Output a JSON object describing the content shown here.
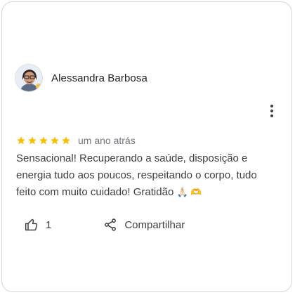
{
  "review": {
    "author_name": "Alessandra Barbosa",
    "rating": 5,
    "rating_max": 5,
    "time_ago": "um ano atrás",
    "text": "Sensacional! Recuperando a saúde, disposição e energia tudo aos poucos, respeitando o corpo, tudo feito com muito cuidado! Gratidão",
    "emojis": "🙏🏻 🫶",
    "like_count": "1",
    "share_label": "Compartilhar"
  },
  "colors": {
    "star": "#FBBC04",
    "text": "#3c4043",
    "secondary_text": "#70757a"
  },
  "icons": [
    "avatar",
    "star-icon",
    "more-vert-icon",
    "thumbs-up-icon",
    "share-icon"
  ]
}
